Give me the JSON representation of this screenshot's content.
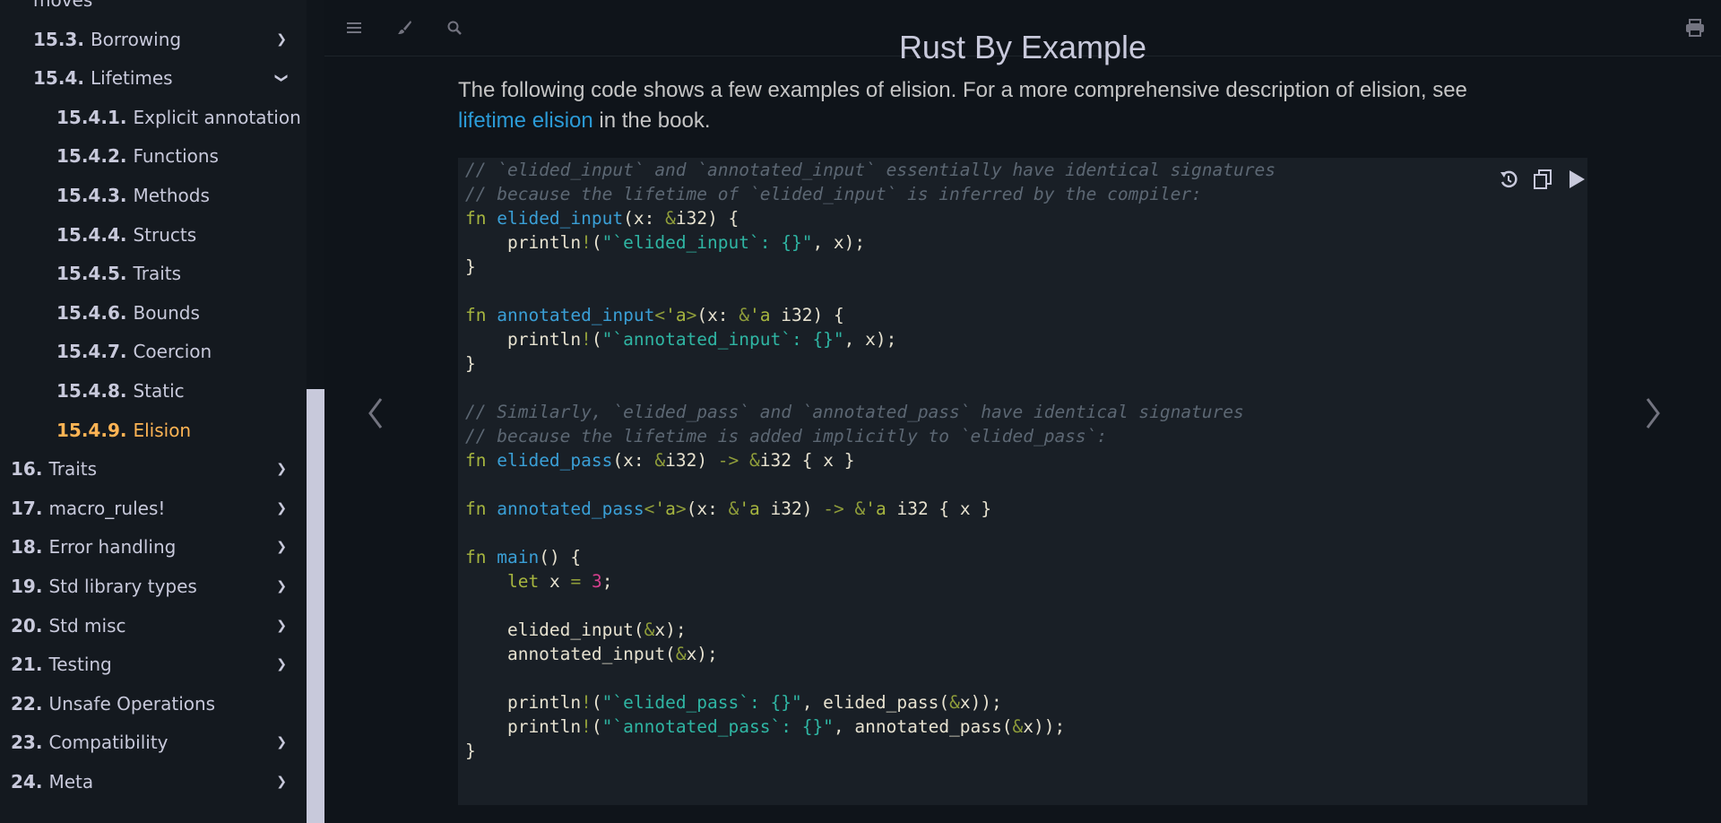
{
  "sidebar": {
    "items": [
      {
        "num": "",
        "label": "moves",
        "level": 1,
        "chevron": "",
        "active": false
      },
      {
        "num": "15.3.",
        "label": "Borrowing",
        "level": 1,
        "chevron": "right",
        "active": false
      },
      {
        "num": "15.4.",
        "label": "Lifetimes",
        "level": 1,
        "chevron": "down",
        "active": false
      },
      {
        "num": "15.4.1.",
        "label": "Explicit annotation",
        "level": 2,
        "chevron": "",
        "active": false
      },
      {
        "num": "15.4.2.",
        "label": "Functions",
        "level": 2,
        "chevron": "",
        "active": false
      },
      {
        "num": "15.4.3.",
        "label": "Methods",
        "level": 2,
        "chevron": "",
        "active": false
      },
      {
        "num": "15.4.4.",
        "label": "Structs",
        "level": 2,
        "chevron": "",
        "active": false
      },
      {
        "num": "15.4.5.",
        "label": "Traits",
        "level": 2,
        "chevron": "",
        "active": false
      },
      {
        "num": "15.4.6.",
        "label": "Bounds",
        "level": 2,
        "chevron": "",
        "active": false
      },
      {
        "num": "15.4.7.",
        "label": "Coercion",
        "level": 2,
        "chevron": "",
        "active": false
      },
      {
        "num": "15.4.8.",
        "label": "Static",
        "level": 2,
        "chevron": "",
        "active": false
      },
      {
        "num": "15.4.9.",
        "label": "Elision",
        "level": 2,
        "chevron": "",
        "active": true
      },
      {
        "num": "16.",
        "label": "Traits",
        "level": 0,
        "chevron": "right",
        "active": false
      },
      {
        "num": "17.",
        "label": "macro_rules!",
        "level": 0,
        "chevron": "right",
        "active": false
      },
      {
        "num": "18.",
        "label": "Error handling",
        "level": 0,
        "chevron": "right",
        "active": false
      },
      {
        "num": "19.",
        "label": "Std library types",
        "level": 0,
        "chevron": "right",
        "active": false
      },
      {
        "num": "20.",
        "label": "Std misc",
        "level": 0,
        "chevron": "right",
        "active": false
      },
      {
        "num": "21.",
        "label": "Testing",
        "level": 0,
        "chevron": "right",
        "active": false
      },
      {
        "num": "22.",
        "label": "Unsafe Operations",
        "level": 0,
        "chevron": "",
        "active": false
      },
      {
        "num": "23.",
        "label": "Compatibility",
        "level": 0,
        "chevron": "right",
        "active": false
      },
      {
        "num": "24.",
        "label": "Meta",
        "level": 0,
        "chevron": "right",
        "active": false
      }
    ]
  },
  "topbar": {
    "title": "Rust By Example",
    "icons": [
      "menu-icon",
      "paintbrush-icon",
      "search-icon",
      "print-icon"
    ]
  },
  "content": {
    "intro_text": "The following code shows a few examples of elision. For a more comprehensive description of elision, see",
    "link_text": "lifetime elision",
    "after_link_text": " in the book."
  },
  "code_block": {
    "buttons": [
      "undo-icon",
      "copy-icon",
      "play-icon"
    ],
    "lines": [
      [
        [
          "cm",
          "// `elided_input` and `annotated_input` essentially have identical signatures"
        ]
      ],
      [
        [
          "cm",
          "// because the lifetime of `elided_input` is inferred by the compiler:"
        ]
      ],
      [
        [
          "kw",
          "fn "
        ],
        [
          "fn",
          "elided_input"
        ],
        [
          "ty",
          "(x: "
        ],
        [
          "op",
          "&"
        ],
        [
          "ty",
          "i32) {"
        ]
      ],
      [
        [
          "ty",
          "    println"
        ],
        [
          "op",
          "!"
        ],
        [
          "ty",
          "("
        ],
        [
          "st",
          "\"`elided_input`: {}\""
        ],
        [
          "ty",
          ", x);"
        ]
      ],
      [
        [
          "ty",
          "}"
        ]
      ],
      [
        [
          "ty",
          ""
        ]
      ],
      [
        [
          "kw",
          "fn "
        ],
        [
          "fn",
          "annotated_input"
        ],
        [
          "op",
          "<"
        ],
        [
          "kw",
          "'a"
        ],
        [
          "op",
          ">"
        ],
        [
          "ty",
          "(x: "
        ],
        [
          "op",
          "&"
        ],
        [
          "kw",
          "'a"
        ],
        [
          "ty",
          " i32) {"
        ]
      ],
      [
        [
          "ty",
          "    println"
        ],
        [
          "op",
          "!"
        ],
        [
          "ty",
          "("
        ],
        [
          "st",
          "\"`annotated_input`: {}\""
        ],
        [
          "ty",
          ", x);"
        ]
      ],
      [
        [
          "ty",
          "}"
        ]
      ],
      [
        [
          "ty",
          ""
        ]
      ],
      [
        [
          "cm",
          "// Similarly, `elided_pass` and `annotated_pass` have identical signatures"
        ]
      ],
      [
        [
          "cm",
          "// because the lifetime is added implicitly to `elided_pass`:"
        ]
      ],
      [
        [
          "kw",
          "fn "
        ],
        [
          "fn",
          "elided_pass"
        ],
        [
          "ty",
          "(x: "
        ],
        [
          "op",
          "&"
        ],
        [
          "ty",
          "i32) "
        ],
        [
          "op",
          "->"
        ],
        [
          "ty",
          " "
        ],
        [
          "op",
          "&"
        ],
        [
          "ty",
          "i32 { x }"
        ]
      ],
      [
        [
          "ty",
          ""
        ]
      ],
      [
        [
          "kw",
          "fn "
        ],
        [
          "fn",
          "annotated_pass"
        ],
        [
          "op",
          "<"
        ],
        [
          "kw",
          "'a"
        ],
        [
          "op",
          ">"
        ],
        [
          "ty",
          "(x: "
        ],
        [
          "op",
          "&"
        ],
        [
          "kw",
          "'a"
        ],
        [
          "ty",
          " i32) "
        ],
        [
          "op",
          "->"
        ],
        [
          "ty",
          " "
        ],
        [
          "op",
          "&"
        ],
        [
          "kw",
          "'a"
        ],
        [
          "ty",
          " i32 { x }"
        ]
      ],
      [
        [
          "ty",
          ""
        ]
      ],
      [
        [
          "kw",
          "fn "
        ],
        [
          "fn",
          "main"
        ],
        [
          "ty",
          "() {"
        ]
      ],
      [
        [
          "ty",
          "    "
        ],
        [
          "kw",
          "let"
        ],
        [
          "ty",
          " x "
        ],
        [
          "op",
          "="
        ],
        [
          "ty",
          " "
        ],
        [
          "nm",
          "3"
        ],
        [
          "ty",
          ";"
        ]
      ],
      [
        [
          "ty",
          ""
        ]
      ],
      [
        [
          "ty",
          "    elided_input("
        ],
        [
          "op",
          "&"
        ],
        [
          "ty",
          "x);"
        ]
      ],
      [
        [
          "ty",
          "    annotated_input("
        ],
        [
          "op",
          "&"
        ],
        [
          "ty",
          "x);"
        ]
      ],
      [
        [
          "ty",
          ""
        ]
      ],
      [
        [
          "ty",
          "    println"
        ],
        [
          "op",
          "!"
        ],
        [
          "ty",
          "("
        ],
        [
          "st",
          "\"`elided_pass`: {}\""
        ],
        [
          "ty",
          ", elided_pass("
        ],
        [
          "op",
          "&"
        ],
        [
          "ty",
          "x));"
        ]
      ],
      [
        [
          "ty",
          "    println"
        ],
        [
          "op",
          "!"
        ],
        [
          "ty",
          "("
        ],
        [
          "st",
          "\"`annotated_pass`: {}\""
        ],
        [
          "ty",
          ", annotated_pass("
        ],
        [
          "op",
          "&"
        ],
        [
          "ty",
          "x));"
        ]
      ],
      [
        [
          "ty",
          "}"
        ]
      ]
    ]
  },
  "nav": {
    "prev_icon": "chevron-left-icon",
    "next_icon": "chevron-right-icon"
  },
  "colors": {
    "sidebar_bg": "#14191f",
    "page_bg": "#0f141a",
    "active": "#ffb454",
    "link": "#2b9bd7"
  }
}
